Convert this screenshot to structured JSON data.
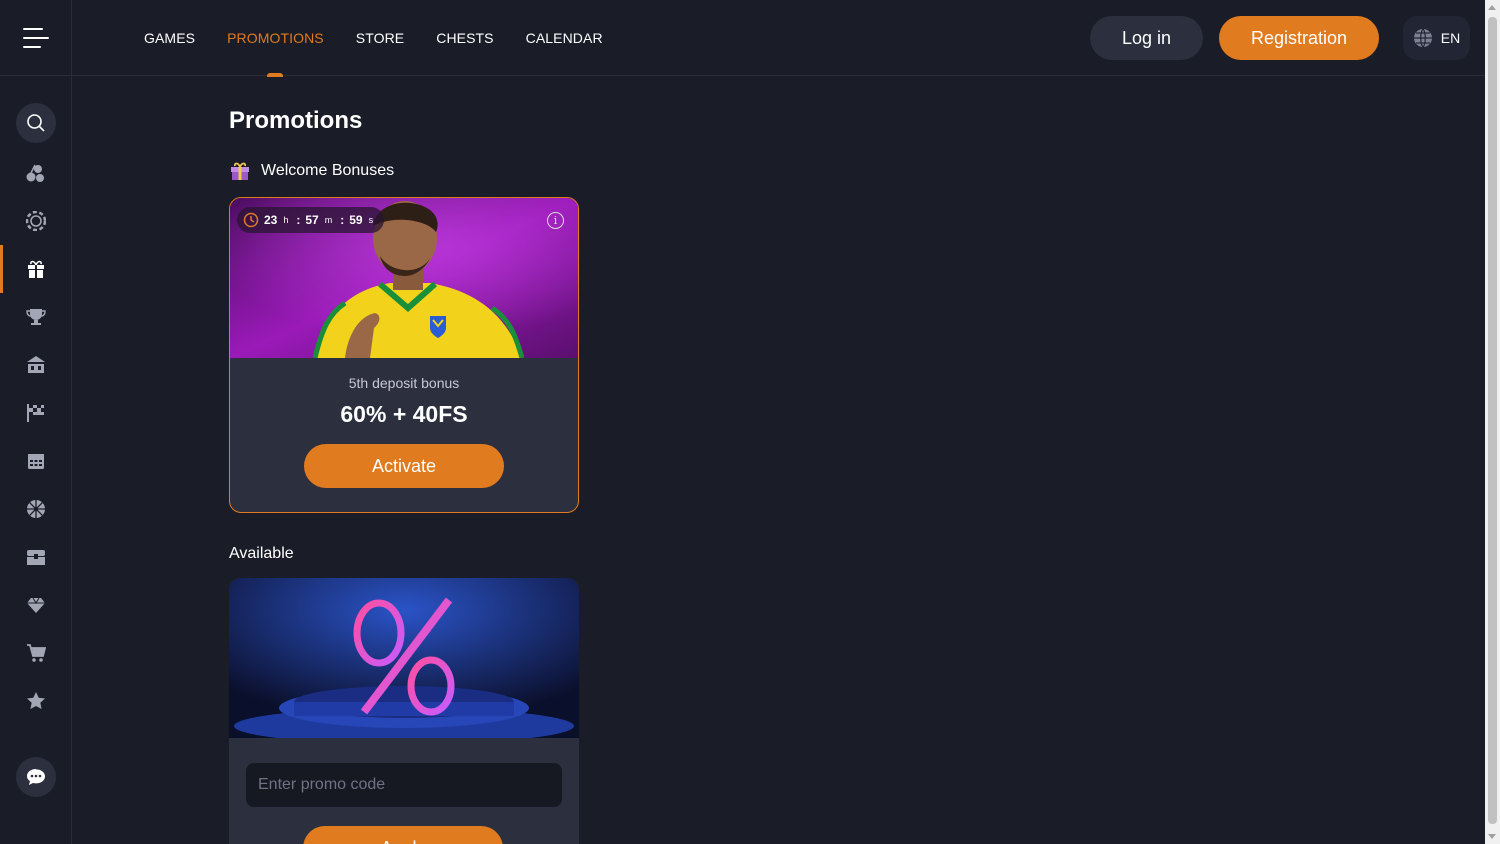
{
  "nav": {
    "items": [
      "GAMES",
      "PROMOTIONS",
      "STORE",
      "CHESTS",
      "CALENDAR"
    ],
    "active": "PROMOTIONS"
  },
  "auth": {
    "login_label": "Log in",
    "register_label": "Registration"
  },
  "language": {
    "code": "EN",
    "icon": "globe-icon"
  },
  "sidebar": {
    "icons": [
      "search-icon",
      "cherries-icon",
      "live-casino-chip-icon",
      "gift-icon",
      "trophy-icon",
      "store-building-icon",
      "race-flag-icon",
      "calendar-icon",
      "wheel-icon",
      "chest-icon",
      "diamond-icon",
      "cart-icon",
      "star-icon",
      "chat-icon"
    ],
    "active": "gift-icon"
  },
  "page": {
    "title": "Promotions",
    "welcome_section": "Welcome Bonuses",
    "available_section": "Available"
  },
  "welcome_card": {
    "timer": {
      "hours": "23",
      "h": "h",
      "minutes": "57",
      "m": "m",
      "seconds": "59",
      "s": "s"
    },
    "subtitle": "5th deposit bonus",
    "bonus": "60% + 40FS",
    "button": "Activate"
  },
  "promo_card": {
    "input_placeholder": "Enter promo code",
    "button": "Apply"
  },
  "colors": {
    "accent": "#e07b1f",
    "background": "#1a1c28",
    "card": "#2b2f3e"
  }
}
